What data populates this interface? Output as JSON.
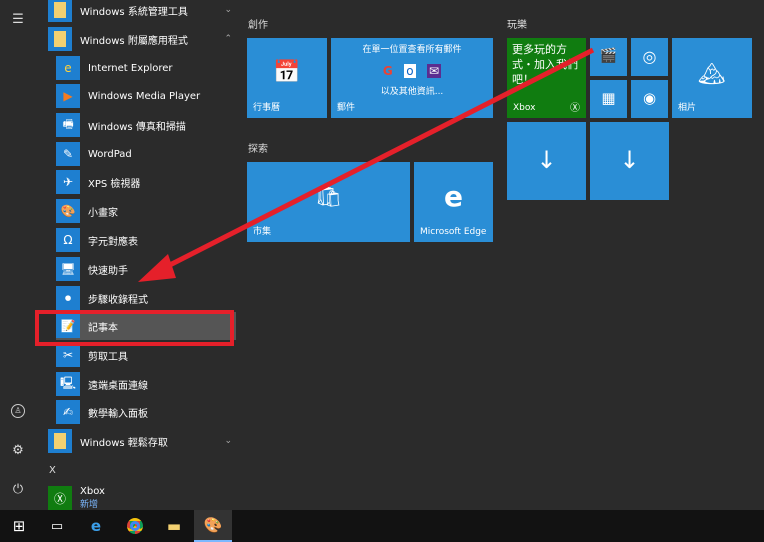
{
  "sidebar": {
    "icons": [
      "hamburger-icon",
      "user-icon",
      "settings-icon",
      "power-icon"
    ]
  },
  "apps": {
    "folders": [
      {
        "label": "Windows 系統管理工具",
        "chev": "⌄"
      },
      {
        "label": "Windows 附屬應用程式",
        "chev": "⌃"
      },
      {
        "label": "Windows 輕鬆存取",
        "chev": "⌄"
      }
    ],
    "items": [
      "Internet Explorer",
      "Windows Media Player",
      "Windows 傳真和掃描",
      "WordPad",
      "XPS 檢視器",
      "小畫家",
      "字元對應表",
      "快速助手",
      "步驟收錄程式",
      "記事本",
      "剪取工具",
      "遠端桌面連線",
      "數學輸入面板"
    ],
    "letter": "X",
    "xbox": {
      "label": "Xbox",
      "sub": "新增"
    }
  },
  "tiles": {
    "create": {
      "title": "創作",
      "calendar": "行事曆",
      "mail_header": "在單一位置查看所有郵件",
      "mail_more": "以及其他資訊...",
      "mail": "郵件"
    },
    "explore": {
      "title": "探索",
      "store": "市集",
      "edge": "Microsoft Edge"
    },
    "play": {
      "title": "玩樂",
      "xbox_text": "更多玩的方式・加入我們吧！",
      "xbox": "Xbox",
      "photos": "相片"
    }
  },
  "colors": {
    "tile": "#2a8ed6",
    "xbox": "#107c10",
    "annotation": "#e5202a"
  }
}
